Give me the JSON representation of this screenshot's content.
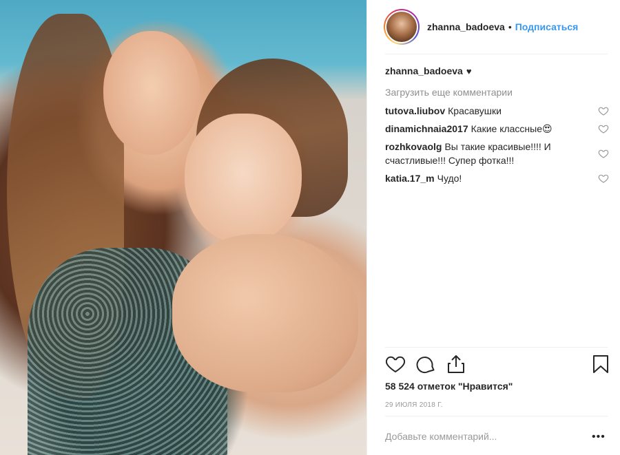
{
  "photo": {
    "alt": ""
  },
  "header": {
    "username": "zhanna_badoeva",
    "separator": "•",
    "follow_label": "Подписаться"
  },
  "caption": {
    "username": "zhanna_badoeva",
    "text": "♥"
  },
  "load_more_label": "Загрузить еще комментарии",
  "comments": [
    {
      "user": "tutova.liubov",
      "text": "Красавушки"
    },
    {
      "user": "dinamichnaia2017",
      "text": "Какие классные😍"
    },
    {
      "user": "rozhkovaolg",
      "text": "Вы такие красивые!!!! И счастливые!!! Супер фотка!!!"
    },
    {
      "user": "katia.17_m",
      "text": "Чудо!"
    }
  ],
  "actions": {
    "like_icon": "heart-outline-icon",
    "comment_icon": "comment-bubble-icon",
    "share_icon": "share-upload-icon",
    "save_icon": "bookmark-icon"
  },
  "likes_text": "58 524 отметок \"Нравится\"",
  "date_text": "29 ИЮЛЯ 2018 Г.",
  "add_comment_placeholder": "Добавьте комментарий...",
  "more_label": "•••",
  "colors": {
    "accent": "#3897f0",
    "text": "#262626",
    "muted": "#8e8e8e",
    "divider": "#efefef"
  }
}
